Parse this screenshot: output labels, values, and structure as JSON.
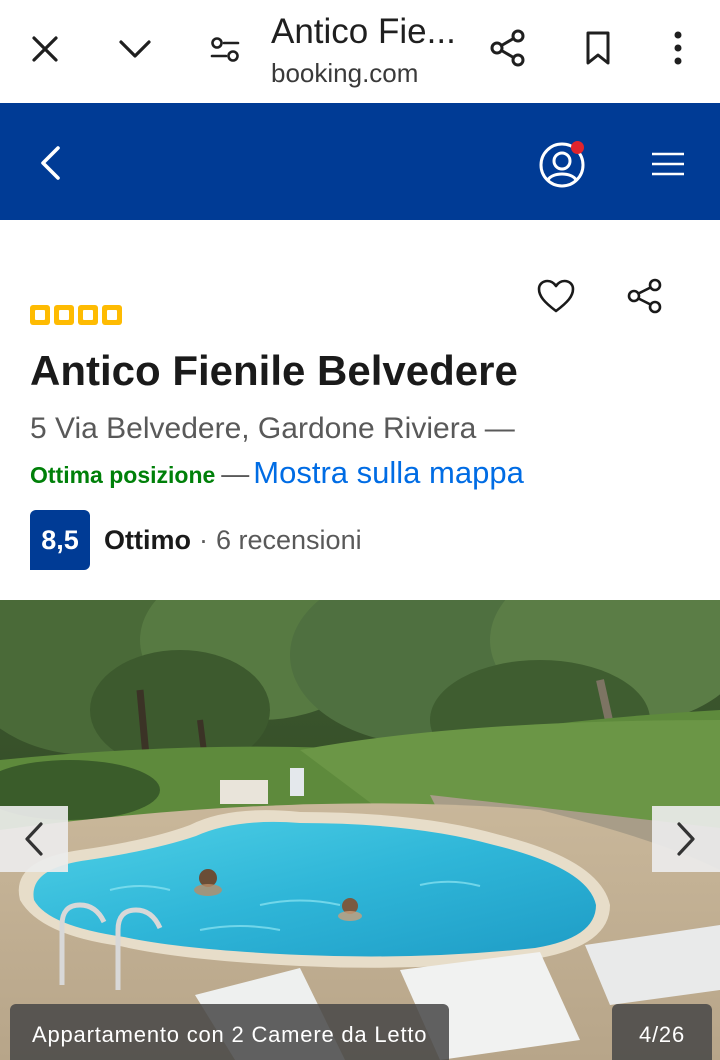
{
  "browser": {
    "tab_title": "Antico Fie...",
    "domain": "booking.com",
    "icons": [
      "close-icon",
      "chevron-down-icon",
      "tune-icon",
      "share-icon",
      "bookmark-icon",
      "more-vert-icon"
    ]
  },
  "header": {
    "background": "#003b95",
    "icons": [
      "back-arrow-icon",
      "account-icon",
      "menu-icon"
    ],
    "notification_dot_color": "#e0242c"
  },
  "property": {
    "star_rating": 4,
    "star_color": "#febb02",
    "name": "Antico Fienile Belvedere",
    "address": "5 Via Belvedere, Gardone Riviera —",
    "location_badge": "Ottima posizione",
    "dash": "—",
    "map_link": "Mostra sulla mappa",
    "score": "8,5",
    "score_word": "Ottimo",
    "score_separator": "·",
    "reviews": "6 recensioni"
  },
  "gallery": {
    "caption": "Appartamento con 2 Camere da Letto",
    "counter": "4/26",
    "icons": [
      "chevron-left-icon",
      "chevron-right-icon"
    ]
  }
}
